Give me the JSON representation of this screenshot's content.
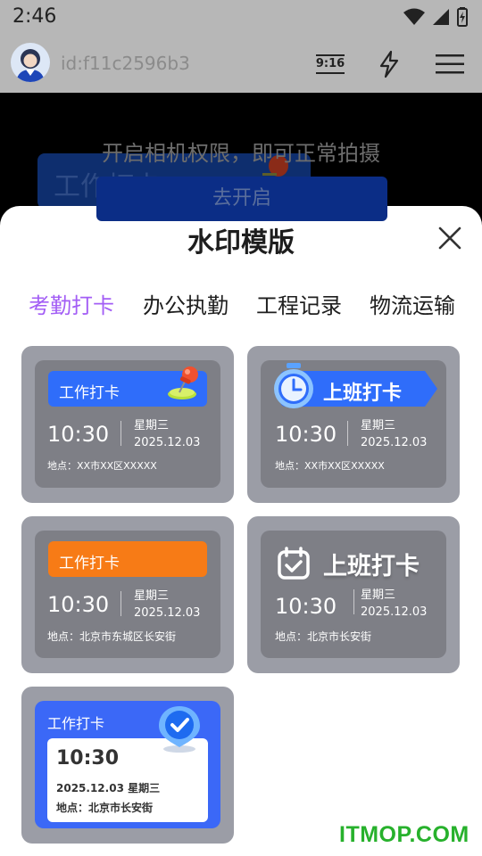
{
  "status_bar": {
    "time": "2:46"
  },
  "top_bar": {
    "user_id": "id:f11c2596b3",
    "ratio_label": "9:16"
  },
  "camera": {
    "permission_message": "开启相机权限，即可正常拍摄",
    "permission_button": "去开启",
    "background_card_text": "工作打卡"
  },
  "sheet": {
    "title": "水印模版",
    "tabs": [
      {
        "label": "考勤打卡",
        "active": true
      },
      {
        "label": "办公执勤",
        "active": false
      },
      {
        "label": "工程记录",
        "active": false
      },
      {
        "label": "物流运输",
        "active": false
      }
    ],
    "templates": [
      {
        "label": "工作打卡",
        "time": "10:30",
        "weekday": "星期三",
        "date": "2025.12.03",
        "location": "地点：XX市XX区XXXXX",
        "accent": "#2f6dfa"
      },
      {
        "label": "上班打卡",
        "time": "10:30",
        "weekday": "星期三",
        "date": "2025.12.03",
        "location": "地点：XX市XX区XXXXX",
        "accent": "#2f6dfa"
      },
      {
        "label": "工作打卡",
        "time": "10:30",
        "weekday": "星期三",
        "date": "2025.12.03",
        "location": "地点：北京市东城区长安街",
        "accent": "#f77b16"
      },
      {
        "label": "上班打卡",
        "time": "10:30",
        "weekday": "星期三",
        "date": "2025.12.03",
        "location": "地点：北京市长安街",
        "accent": "#ffffff"
      },
      {
        "label": "工作打卡",
        "time": "10:30",
        "date_weekday": "2025.12.03   星期三",
        "location": "地点：北京市长安街",
        "accent": "#3b68f7"
      }
    ]
  },
  "watermark": "ITMOP.COM"
}
